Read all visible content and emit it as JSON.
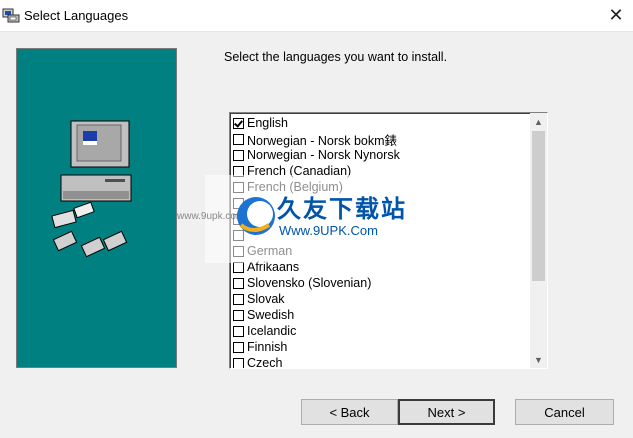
{
  "window": {
    "title": "Select Languages",
    "close_symbol": "✕"
  },
  "instruction": "Select the languages you want to install.",
  "languages": [
    {
      "label": "English",
      "checked": true
    },
    {
      "label": "Norwegian - Norsk bokm錶",
      "checked": false
    },
    {
      "label": "Norwegian - Norsk Nynorsk",
      "checked": false
    },
    {
      "label": "French (Canadian)",
      "checked": false
    },
    {
      "label": "French (Belgium)",
      "checked": false
    },
    {
      "label": "",
      "checked": false
    },
    {
      "label": "",
      "checked": false
    },
    {
      "label": "",
      "checked": false
    },
    {
      "label": "German",
      "checked": false
    },
    {
      "label": "Afrikaans",
      "checked": false
    },
    {
      "label": "Slovensko (Slovenian)",
      "checked": false
    },
    {
      "label": "Slovak",
      "checked": false
    },
    {
      "label": "Swedish",
      "checked": false
    },
    {
      "label": "Icelandic",
      "checked": false
    },
    {
      "label": "Finnish",
      "checked": false
    },
    {
      "label": "Czech",
      "checked": false
    }
  ],
  "buttons": {
    "back": "< Back",
    "next": "Next >",
    "cancel": "Cancel"
  },
  "watermark": {
    "brand": "久友下载站",
    "url": "Www.9UPK.Com",
    "small": "www.9upk.com"
  },
  "colors": {
    "side_panel": "#008080",
    "watermark_blue": "#0055aa"
  }
}
